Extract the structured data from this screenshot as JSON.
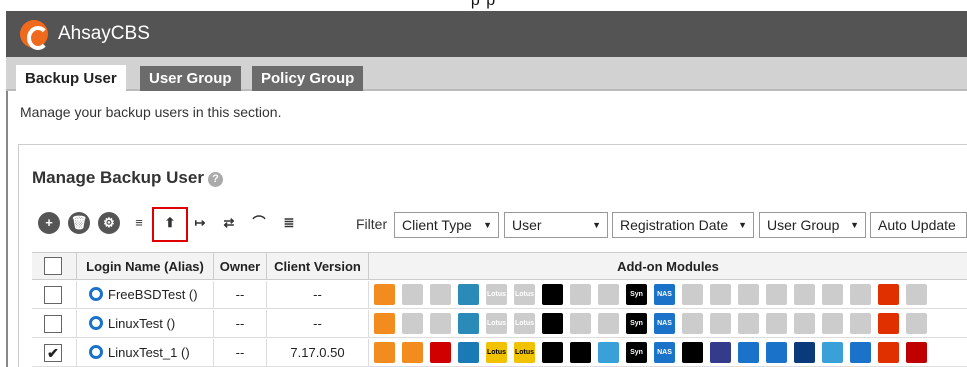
{
  "app": {
    "name": "AhsayCBS",
    "top_strip": "p  p"
  },
  "tabs": [
    {
      "label": "Backup User",
      "active": true
    },
    {
      "label": "User Group",
      "active": false
    },
    {
      "label": "Policy Group",
      "active": false
    }
  ],
  "intro": "Manage your backup users in this section.",
  "panel": {
    "title": "Manage Backup User",
    "help": "?"
  },
  "toolbar": {
    "icons": [
      "add-icon",
      "delete-icon",
      "settings-icon",
      "list-icon",
      "upload-icon",
      "export-icon",
      "transfer-user-icon",
      "chart-icon",
      "contacts-icon"
    ],
    "glyphs": [
      "+",
      "🗑",
      "⚙",
      "≡",
      "⬆",
      "↦",
      "⇄",
      "⌒",
      "≣"
    ]
  },
  "filter": {
    "label": "Filter",
    "selects": [
      "Client Type",
      "User",
      "Registration Date",
      "User Group",
      "Auto Update"
    ]
  },
  "table": {
    "headers": [
      "Login Name (Alias)",
      "Owner",
      "Client Version",
      "Add-on Modules"
    ],
    "rows": [
      {
        "checked": false,
        "login": "FreeBSDTest ()",
        "owner": "--",
        "version": "--",
        "active": false
      },
      {
        "checked": false,
        "login": "LinuxTest ()",
        "owner": "--",
        "version": "--",
        "active": false
      },
      {
        "checked": true,
        "login": "LinuxTest_1 ()",
        "owner": "--",
        "version": "7.17.0.50",
        "active": true
      }
    ],
    "check_mark": "✔"
  },
  "modules": {
    "labels": [
      "",
      "",
      "",
      "",
      "Lotus",
      "Lotus",
      "",
      "",
      "",
      "Syn NAS",
      "NAS",
      "",
      "",
      "",
      "",
      "",
      "",
      "",
      "",
      ""
    ],
    "active_colors": [
      "#f28c1e",
      "#f28c1e",
      "#d00000",
      "#1a7ab5",
      "#f0c200",
      "#f0c200",
      "#000000",
      "#000000",
      "#3aa0d8",
      "#000000",
      "#1a73c9",
      "#000000",
      "#333b8a",
      "#1a73c9",
      "#1a73c9",
      "#0a3a7a",
      "#3aa0d8",
      "#1a73c9",
      "#e03000",
      "#c00000"
    ],
    "inactive_colors": [
      "#f28c1e",
      "#cccccc",
      "#cccccc",
      "#2a8ab8",
      "#cccccc",
      "#cccccc",
      "#000000",
      "#cccccc",
      "#cccccc",
      "#000000",
      "#1a73c9",
      "#cccccc",
      "#cccccc",
      "#cccccc",
      "#cccccc",
      "#cccccc",
      "#cccccc",
      "#cccccc",
      "#e03000",
      "#cccccc"
    ]
  }
}
